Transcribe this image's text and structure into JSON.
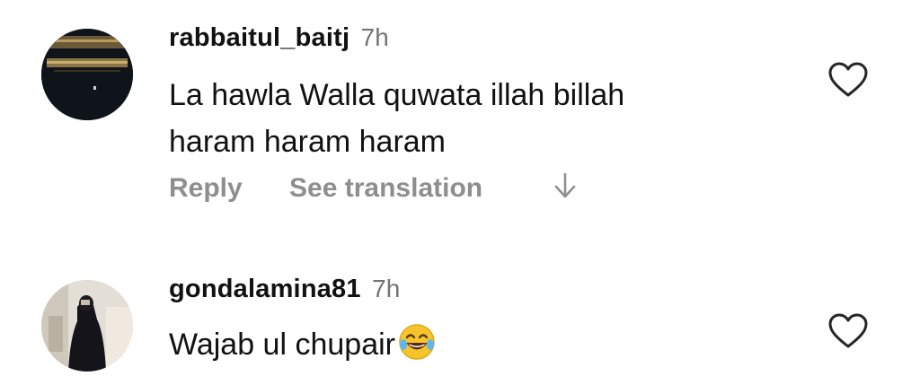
{
  "comments": [
    {
      "username": "rabbaitul_baitj",
      "time": "7h",
      "text_lines": [
        "La hawla Walla quwata illah billah",
        "haram haram haram"
      ],
      "actions": {
        "reply": "Reply",
        "translate": "See translation"
      },
      "like_icon": "heart-outline-icon",
      "avatar_icon": "kaaba-avatar"
    },
    {
      "username": "gondalamina81",
      "time": "7h",
      "text": "Wajab ul chupair",
      "emoji": "tears-of-joy-emoji",
      "like_icon": "heart-outline-icon",
      "avatar_icon": "person-in-black-abaya-avatar"
    }
  ],
  "colors": {
    "text": "#111111",
    "secondary": "#8e8e8e",
    "timestamp": "#737373",
    "background": "#ffffff"
  }
}
